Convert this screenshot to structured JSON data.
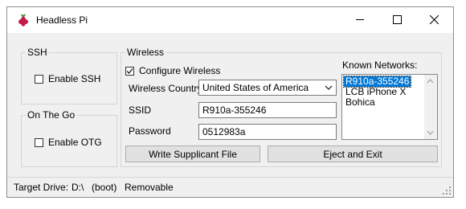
{
  "window": {
    "title": "Headless Pi",
    "colors": {
      "titlebar_bg": "#ffffff",
      "client_bg": "#f0f0f0",
      "selection": "#0078d7"
    },
    "icons": [
      "raspberry-pi-logo",
      "minimize",
      "maximize",
      "close"
    ]
  },
  "ssh": {
    "legend": "SSH",
    "enable_label": "Enable SSH",
    "checked": false
  },
  "otg": {
    "legend": "On The Go",
    "enable_label": "Enable OTG",
    "checked": false
  },
  "wireless": {
    "legend": "Wireless",
    "configure_label": "Configure Wireless",
    "configure_checked": true,
    "country_label": "Wireless Country",
    "country_value": "United States of America",
    "ssid_label": "SSID",
    "ssid_value": "R910a-355246",
    "password_label": "Password",
    "password_value": "0512983a",
    "known_label": "Known Networks:",
    "known_networks": [
      "R910a-355246",
      "LCB iPhone X",
      "Bohica"
    ],
    "selected_index": 0
  },
  "buttons": {
    "write": "Write Supplicant File",
    "eject": "Eject and Exit"
  },
  "status": {
    "label": "Target Drive:",
    "drive": "D:\\",
    "volume": "(boot)",
    "type": "Removable"
  }
}
